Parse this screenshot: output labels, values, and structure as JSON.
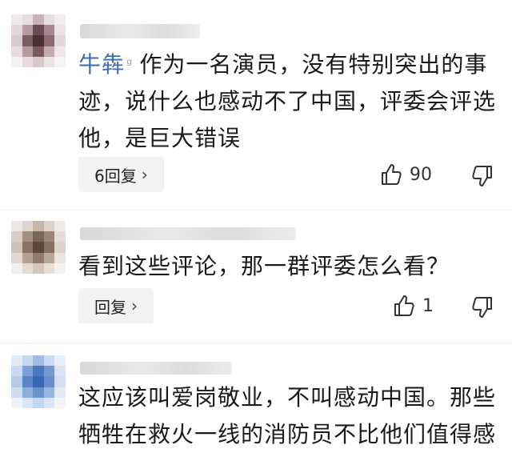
{
  "comments": [
    {
      "username": "牛犇",
      "badge": "ᵍ",
      "text": "作为一名演员，没有特别突出的事迹，说什么也感动不了中国，评委会评选他，是巨大错误",
      "reply_label": "6回复",
      "like_count": "90"
    },
    {
      "text": "看到这些评论，那一群评委怎么看？",
      "reply_label": "回复",
      "like_count": "1"
    },
    {
      "text": "这应该叫爱岗敬业，不叫感动中国。那些牺牲在救火一线的消防员不比他们值得感"
    }
  ],
  "icons": {
    "chevron": "›",
    "like": "thumb-up-icon",
    "dislike": "thumb-down-icon"
  },
  "colors": {
    "username": "#3f6fb0",
    "reply_bg": "#f2f2f2",
    "text": "#1a1a1a"
  }
}
